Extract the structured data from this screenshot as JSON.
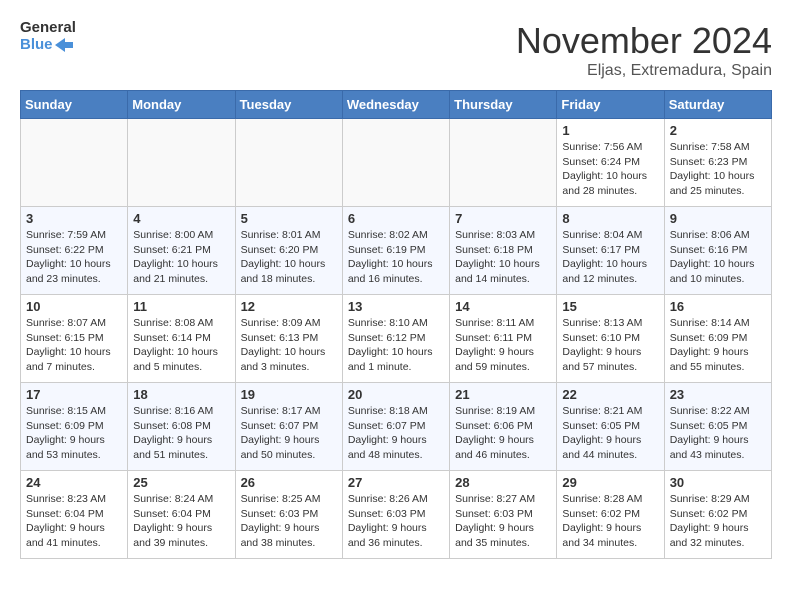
{
  "logo": {
    "line1": "General",
    "line2": "Blue"
  },
  "title": "November 2024",
  "location": "Eljas, Extremadura, Spain",
  "days_of_week": [
    "Sunday",
    "Monday",
    "Tuesday",
    "Wednesday",
    "Thursday",
    "Friday",
    "Saturday"
  ],
  "weeks": [
    [
      {
        "day": "",
        "sunrise": "",
        "sunset": "",
        "daylight": ""
      },
      {
        "day": "",
        "sunrise": "",
        "sunset": "",
        "daylight": ""
      },
      {
        "day": "",
        "sunrise": "",
        "sunset": "",
        "daylight": ""
      },
      {
        "day": "",
        "sunrise": "",
        "sunset": "",
        "daylight": ""
      },
      {
        "day": "",
        "sunrise": "",
        "sunset": "",
        "daylight": ""
      },
      {
        "day": "1",
        "sunrise": "Sunrise: 7:56 AM",
        "sunset": "Sunset: 6:24 PM",
        "daylight": "Daylight: 10 hours and 28 minutes."
      },
      {
        "day": "2",
        "sunrise": "Sunrise: 7:58 AM",
        "sunset": "Sunset: 6:23 PM",
        "daylight": "Daylight: 10 hours and 25 minutes."
      }
    ],
    [
      {
        "day": "3",
        "sunrise": "Sunrise: 7:59 AM",
        "sunset": "Sunset: 6:22 PM",
        "daylight": "Daylight: 10 hours and 23 minutes."
      },
      {
        "day": "4",
        "sunrise": "Sunrise: 8:00 AM",
        "sunset": "Sunset: 6:21 PM",
        "daylight": "Daylight: 10 hours and 21 minutes."
      },
      {
        "day": "5",
        "sunrise": "Sunrise: 8:01 AM",
        "sunset": "Sunset: 6:20 PM",
        "daylight": "Daylight: 10 hours and 18 minutes."
      },
      {
        "day": "6",
        "sunrise": "Sunrise: 8:02 AM",
        "sunset": "Sunset: 6:19 PM",
        "daylight": "Daylight: 10 hours and 16 minutes."
      },
      {
        "day": "7",
        "sunrise": "Sunrise: 8:03 AM",
        "sunset": "Sunset: 6:18 PM",
        "daylight": "Daylight: 10 hours and 14 minutes."
      },
      {
        "day": "8",
        "sunrise": "Sunrise: 8:04 AM",
        "sunset": "Sunset: 6:17 PM",
        "daylight": "Daylight: 10 hours and 12 minutes."
      },
      {
        "day": "9",
        "sunrise": "Sunrise: 8:06 AM",
        "sunset": "Sunset: 6:16 PM",
        "daylight": "Daylight: 10 hours and 10 minutes."
      }
    ],
    [
      {
        "day": "10",
        "sunrise": "Sunrise: 8:07 AM",
        "sunset": "Sunset: 6:15 PM",
        "daylight": "Daylight: 10 hours and 7 minutes."
      },
      {
        "day": "11",
        "sunrise": "Sunrise: 8:08 AM",
        "sunset": "Sunset: 6:14 PM",
        "daylight": "Daylight: 10 hours and 5 minutes."
      },
      {
        "day": "12",
        "sunrise": "Sunrise: 8:09 AM",
        "sunset": "Sunset: 6:13 PM",
        "daylight": "Daylight: 10 hours and 3 minutes."
      },
      {
        "day": "13",
        "sunrise": "Sunrise: 8:10 AM",
        "sunset": "Sunset: 6:12 PM",
        "daylight": "Daylight: 10 hours and 1 minute."
      },
      {
        "day": "14",
        "sunrise": "Sunrise: 8:11 AM",
        "sunset": "Sunset: 6:11 PM",
        "daylight": "Daylight: 9 hours and 59 minutes."
      },
      {
        "day": "15",
        "sunrise": "Sunrise: 8:13 AM",
        "sunset": "Sunset: 6:10 PM",
        "daylight": "Daylight: 9 hours and 57 minutes."
      },
      {
        "day": "16",
        "sunrise": "Sunrise: 8:14 AM",
        "sunset": "Sunset: 6:09 PM",
        "daylight": "Daylight: 9 hours and 55 minutes."
      }
    ],
    [
      {
        "day": "17",
        "sunrise": "Sunrise: 8:15 AM",
        "sunset": "Sunset: 6:09 PM",
        "daylight": "Daylight: 9 hours and 53 minutes."
      },
      {
        "day": "18",
        "sunrise": "Sunrise: 8:16 AM",
        "sunset": "Sunset: 6:08 PM",
        "daylight": "Daylight: 9 hours and 51 minutes."
      },
      {
        "day": "19",
        "sunrise": "Sunrise: 8:17 AM",
        "sunset": "Sunset: 6:07 PM",
        "daylight": "Daylight: 9 hours and 50 minutes."
      },
      {
        "day": "20",
        "sunrise": "Sunrise: 8:18 AM",
        "sunset": "Sunset: 6:07 PM",
        "daylight": "Daylight: 9 hours and 48 minutes."
      },
      {
        "day": "21",
        "sunrise": "Sunrise: 8:19 AM",
        "sunset": "Sunset: 6:06 PM",
        "daylight": "Daylight: 9 hours and 46 minutes."
      },
      {
        "day": "22",
        "sunrise": "Sunrise: 8:21 AM",
        "sunset": "Sunset: 6:05 PM",
        "daylight": "Daylight: 9 hours and 44 minutes."
      },
      {
        "day": "23",
        "sunrise": "Sunrise: 8:22 AM",
        "sunset": "Sunset: 6:05 PM",
        "daylight": "Daylight: 9 hours and 43 minutes."
      }
    ],
    [
      {
        "day": "24",
        "sunrise": "Sunrise: 8:23 AM",
        "sunset": "Sunset: 6:04 PM",
        "daylight": "Daylight: 9 hours and 41 minutes."
      },
      {
        "day": "25",
        "sunrise": "Sunrise: 8:24 AM",
        "sunset": "Sunset: 6:04 PM",
        "daylight": "Daylight: 9 hours and 39 minutes."
      },
      {
        "day": "26",
        "sunrise": "Sunrise: 8:25 AM",
        "sunset": "Sunset: 6:03 PM",
        "daylight": "Daylight: 9 hours and 38 minutes."
      },
      {
        "day": "27",
        "sunrise": "Sunrise: 8:26 AM",
        "sunset": "Sunset: 6:03 PM",
        "daylight": "Daylight: 9 hours and 36 minutes."
      },
      {
        "day": "28",
        "sunrise": "Sunrise: 8:27 AM",
        "sunset": "Sunset: 6:03 PM",
        "daylight": "Daylight: 9 hours and 35 minutes."
      },
      {
        "day": "29",
        "sunrise": "Sunrise: 8:28 AM",
        "sunset": "Sunset: 6:02 PM",
        "daylight": "Daylight: 9 hours and 34 minutes."
      },
      {
        "day": "30",
        "sunrise": "Sunrise: 8:29 AM",
        "sunset": "Sunset: 6:02 PM",
        "daylight": "Daylight: 9 hours and 32 minutes."
      }
    ]
  ]
}
